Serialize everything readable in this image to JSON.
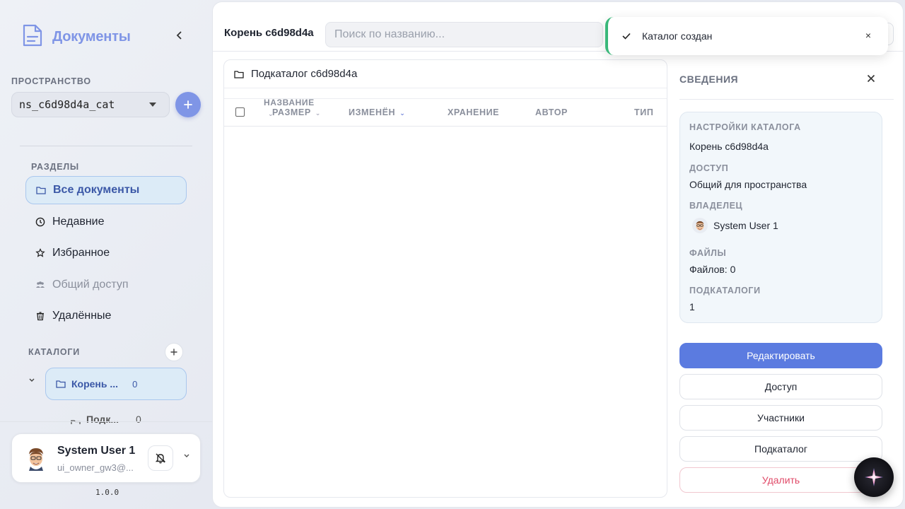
{
  "app": {
    "title": "Документы",
    "version": "1.0.0"
  },
  "space": {
    "label": "ПРОСТРАНСТВО",
    "selected": "ns_c6d98d4a_cat"
  },
  "sections": {
    "label": "РАЗДЕЛЫ",
    "items": [
      {
        "label": "Все документы"
      },
      {
        "label": "Недавние"
      },
      {
        "label": "Избранное"
      },
      {
        "label": "Общий доступ"
      },
      {
        "label": "Удалённые"
      }
    ]
  },
  "catalogs": {
    "label": "КАТАЛОГИ",
    "root": {
      "label": "Корень ...",
      "count": "0"
    },
    "child": {
      "label": "Подк...",
      "count": "0"
    }
  },
  "user": {
    "name": "System User 1",
    "email": "ui_owner_gw3@..."
  },
  "topbar": {
    "crumb": "Корень c6d98d4a",
    "search_placeholder": "Поиск по названию..."
  },
  "toast": {
    "message": "Каталог создан",
    "close": "×"
  },
  "list": {
    "subfolder": "Подкаталог c6d98d4a",
    "columns": {
      "name": "НАЗВАНИЕ",
      "size": "РАЗМЕР",
      "modified": "ИЗМЕНЁН",
      "storage": "ХРАНЕНИЕ",
      "author": "АВТОР",
      "type": "ТИП"
    }
  },
  "details": {
    "title": "СВЕДЕНИЯ",
    "settings_label": "НАСТРОЙКИ КАТАЛОГА",
    "settings_value": "Корень c6d98d4a",
    "access_label": "ДОСТУП",
    "access_value": "Общий для пространства",
    "owner_label": "ВЛАДЕЛЕЦ",
    "owner_value": "System User 1",
    "files_label": "ФАЙЛЫ",
    "files_value": "Файлов: 0",
    "sub_label": "ПОДКАТАЛОГИ",
    "sub_value": "1",
    "buttons": {
      "edit": "Редактировать",
      "access": "Доступ",
      "members": "Участники",
      "subcatalog": "Подкаталог",
      "delete": "Удалить"
    }
  },
  "colors": {
    "accent": "#5b7be0",
    "logo": "#7f95e6",
    "success": "#3ab87a",
    "danger": "#e04a68",
    "active_bg": "#dcebf7"
  }
}
